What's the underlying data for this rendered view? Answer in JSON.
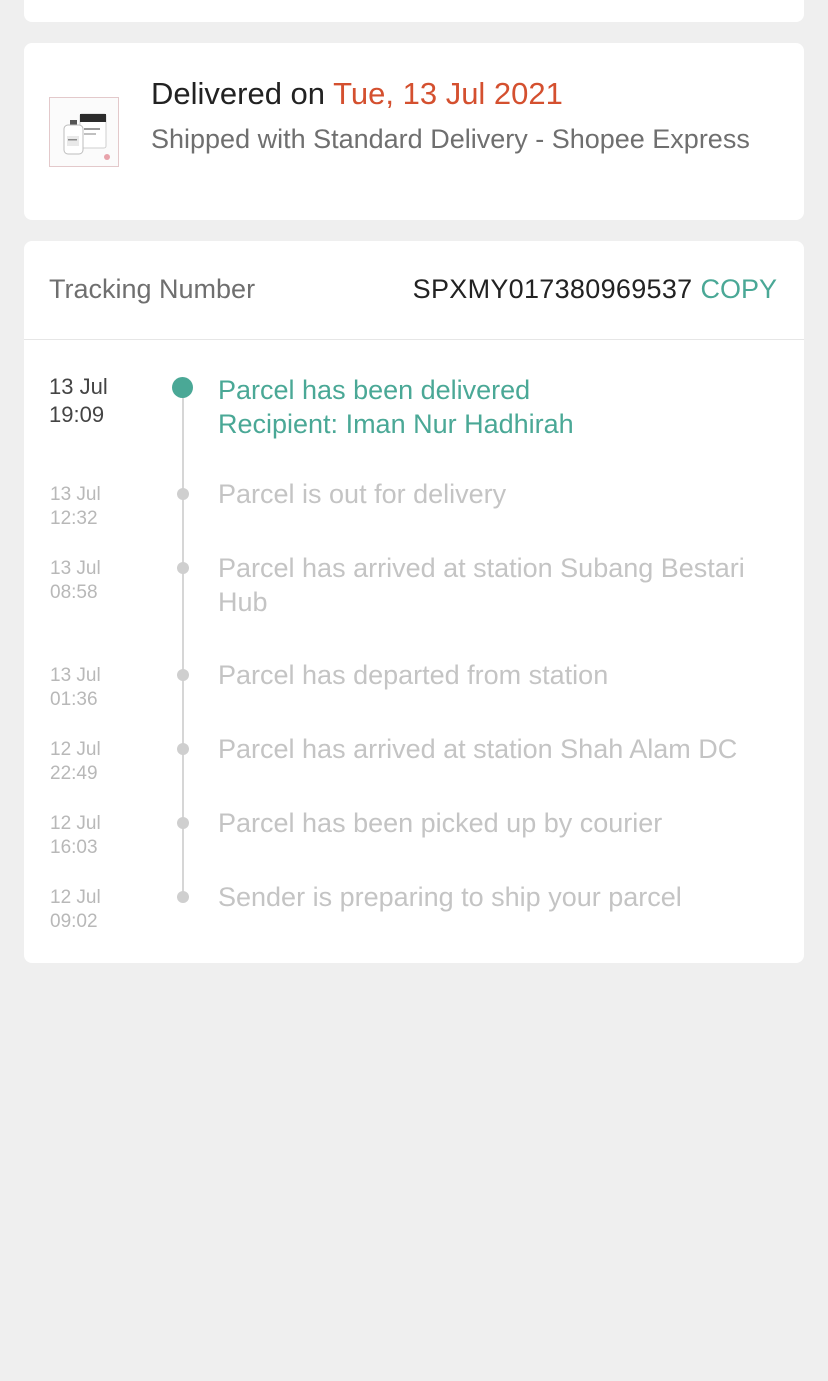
{
  "delivery": {
    "delivered_prefix": "Delivered on ",
    "delivered_date": "Tue, 13 Jul 2021",
    "shipping_info": "Shipped with Standard Delivery  - Shopee Express"
  },
  "tracking": {
    "label": "Tracking Number",
    "number": "SPXMY017380969537",
    "copy_label": "COPY",
    "events": [
      {
        "date": "13 Jul",
        "time": "19:09",
        "line1": "Parcel has been delivered",
        "line2": "Recipient: Iman Nur Hadhirah",
        "current": true
      },
      {
        "date": "13 Jul",
        "time": "12:32",
        "line1": "Parcel is out for delivery",
        "line2": ""
      },
      {
        "date": "13 Jul",
        "time": "08:58",
        "line1": "Parcel has arrived at station Subang Bestari Hub",
        "line2": ""
      },
      {
        "date": "13 Jul",
        "time": "01:36",
        "line1": "Parcel has departed from station",
        "line2": ""
      },
      {
        "date": "12 Jul",
        "time": "22:49",
        "line1": "Parcel has arrived at station Shah Alam DC",
        "line2": ""
      },
      {
        "date": "12 Jul",
        "time": "16:03",
        "line1": "Parcel has been picked up by courier",
        "line2": ""
      },
      {
        "date": "12 Jul",
        "time": "09:02",
        "line1": "Sender is preparing to ship your parcel",
        "line2": ""
      }
    ]
  },
  "colors": {
    "accent": "#4aa896",
    "date_highlight": "#d4502f",
    "background": "#efefef"
  },
  "icons": {
    "product_thumbnail": "product-bottle-image"
  }
}
